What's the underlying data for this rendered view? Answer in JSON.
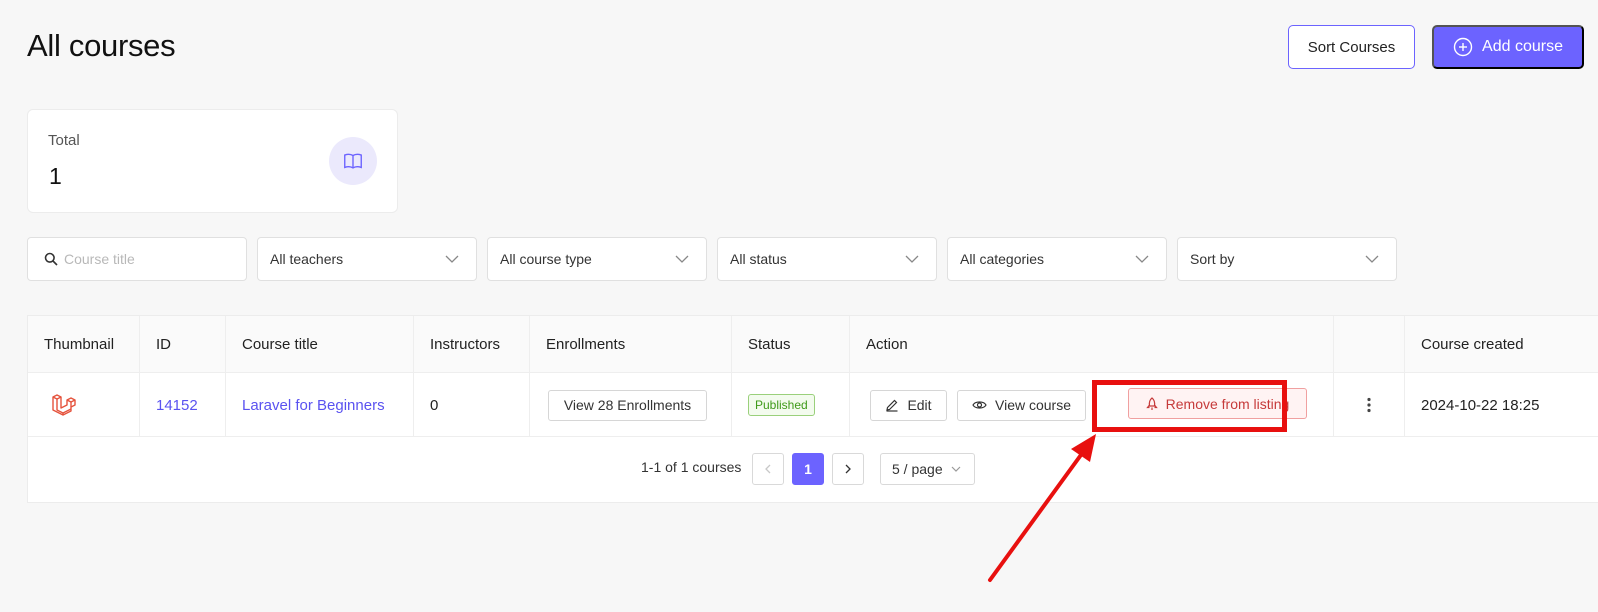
{
  "page": {
    "title": "All courses"
  },
  "header": {
    "sort_label": "Sort Courses",
    "add_label": "Add course"
  },
  "stat": {
    "label": "Total",
    "value": "1"
  },
  "filters": {
    "search_placeholder": "Course title",
    "teachers": "All teachers",
    "course_type": "All course type",
    "status": "All status",
    "categories": "All categories",
    "sort": "Sort by"
  },
  "table": {
    "columns": [
      "Thumbnail",
      "ID",
      "Course title",
      "Instructors",
      "Enrollments",
      "Status",
      "Action",
      "",
      "Course created"
    ],
    "rows": [
      {
        "id": "14152",
        "title": "Laravel for Beginners",
        "instructors": "0",
        "enrollments_label": "View 28 Enrollments",
        "status": "Published",
        "actions": {
          "edit": "Edit",
          "view": "View course",
          "remove": "Remove from listing"
        },
        "created": "2024-10-22 18:25"
      }
    ]
  },
  "pagination": {
    "summary": "1-1 of 1 courses",
    "current_page": "1",
    "page_size": "5 / page"
  },
  "colors": {
    "accent": "#6c63ff",
    "danger": "#e8100f"
  }
}
